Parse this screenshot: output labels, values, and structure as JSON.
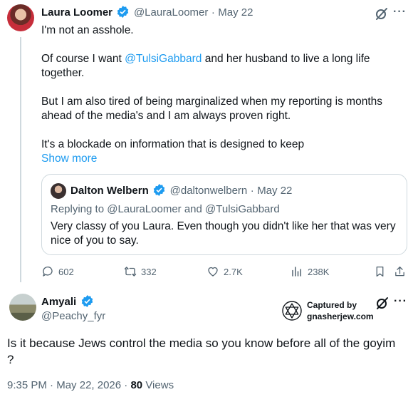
{
  "tweet": {
    "author_name": "Laura Loomer",
    "author_handle": "@LauraLoomer",
    "separator": "·",
    "date": "May 22",
    "line1": "I'm not an asshole.",
    "p2_pre": "Of course I want ",
    "p2_link": "@TulsiGabbard",
    "p2_post": " and her husband to live a long life",
    "p2_line2": "together.",
    "p3_line1": "But I am also tired of being marginalized when my reporting is months",
    "p3_line2": "ahead of the media's and I am always proven right.",
    "p4_line1": "It's a blockade on information that is designed to keep",
    "show_more": "Show more",
    "icons": {
      "grok": "grok-icon",
      "more": "more-dots-icon",
      "verified": "verified-badge-icon"
    }
  },
  "quote": {
    "author_name": "Dalton Welbern",
    "author_handle": "@daltonwelbern",
    "separator": "·",
    "date": "May 22",
    "replying_to": "Replying to @LauraLoomer and @TulsiGabbard",
    "line1": "Very classy of you Laura. Even though you didn't like her that was very",
    "line2": "nice of you to say."
  },
  "actions": {
    "replies": "602",
    "reposts": "332",
    "likes": "2.7K",
    "views": "238K",
    "icons": [
      "reply-icon",
      "repost-icon",
      "like-icon",
      "views-icon",
      "bookmark-icon",
      "share-icon"
    ]
  },
  "reply": {
    "author_name": "Amyali",
    "author_handle": "@Peachy_fyr",
    "watermark_line1": "Captured by",
    "watermark_line2": "gnasherjew.com",
    "text_line1": "Is it because Jews control the media so you know before all of the goyim",
    "text_line2": "?",
    "time": "9:35 PM",
    "dot": "·",
    "date": "May 22, 2026",
    "views_count": "80",
    "views_label": "Views"
  },
  "colors": {
    "accent": "#1d9bf0",
    "text": "#0f1419",
    "muted": "#536471",
    "border": "#cfd9de"
  }
}
